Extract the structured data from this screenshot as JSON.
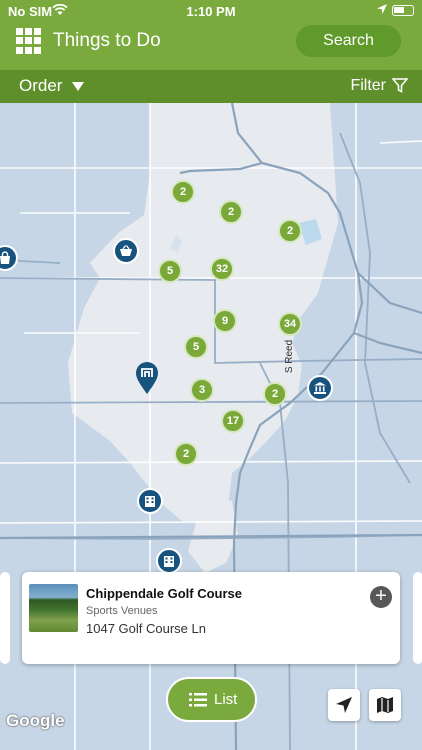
{
  "status": {
    "carrier": "No SIM",
    "time": "1:10 PM"
  },
  "header": {
    "title": "Things to Do",
    "search_label": "Search"
  },
  "toolbar": {
    "order_label": "Order",
    "filter_label": "Filter"
  },
  "map": {
    "clusters": [
      "2",
      "2",
      "2",
      "5",
      "32",
      "9",
      "34",
      "5",
      "3",
      "2",
      "17",
      "2"
    ],
    "street_label": "S Reed",
    "attribution": "Google"
  },
  "card": {
    "name": "Chippendale Golf Course",
    "category": "Sports Venues",
    "address": "1047 Golf Course Ln"
  },
  "buttons": {
    "list_label": "List"
  },
  "colors": {
    "accent": "#7aaa3e",
    "accent_dark": "#5f8f2b",
    "poi": "#18537f",
    "map_water": "#c6d6e6",
    "map_land": "#e8ecf0"
  }
}
